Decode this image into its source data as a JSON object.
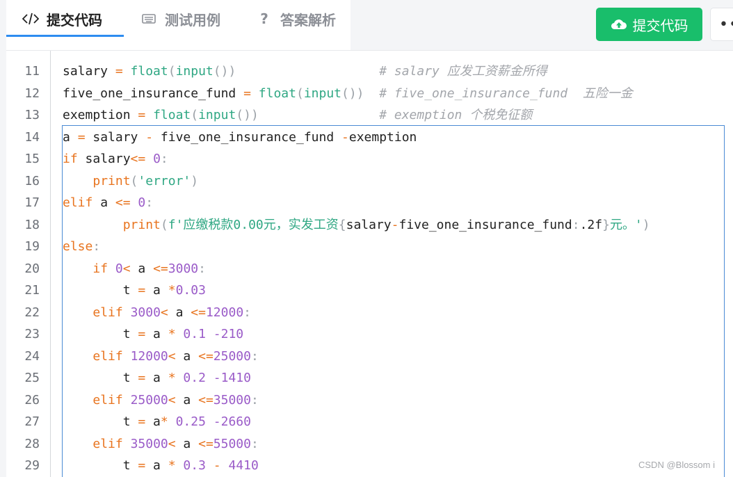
{
  "tabs": [
    {
      "label": "提交代码",
      "icon": "code-icon",
      "active": true
    },
    {
      "label": "测试用例",
      "icon": "keyboard-icon",
      "active": false
    },
    {
      "label": "答案解析",
      "icon": "question-icon",
      "active": false
    }
  ],
  "actions": {
    "submit_label": "提交代码",
    "submit_icon": "cloud-upload-icon",
    "more_icon": "more-icon",
    "more_label": "••"
  },
  "colors": {
    "accent": "#2d8cf0",
    "submit": "#19be6b",
    "keyword": "#e8741f",
    "builtin": "#2fa783",
    "number": "#9a5bc8",
    "comment": "#a3a6ab"
  },
  "editor": {
    "line_numbers": [
      "11",
      "12",
      "13",
      "14",
      "15",
      "16",
      "17",
      "18",
      "19",
      "20",
      "21",
      "22",
      "23",
      "24",
      "25",
      "26",
      "27",
      "28",
      "29"
    ],
    "lines": [
      {
        "tokens": [
          [
            "v",
            "salary "
          ],
          [
            "o",
            "="
          ],
          [
            "v",
            " "
          ],
          [
            "f",
            "float"
          ],
          [
            "p",
            "("
          ],
          [
            "f",
            "input"
          ],
          [
            "p",
            "())"
          ],
          [
            "v",
            "                   "
          ],
          [
            "c",
            "# salary 应发工资薪金所得"
          ]
        ]
      },
      {
        "tokens": [
          [
            "v",
            "five_one_insurance_fund "
          ],
          [
            "o",
            "="
          ],
          [
            "v",
            " "
          ],
          [
            "f",
            "float"
          ],
          [
            "p",
            "("
          ],
          [
            "f",
            "input"
          ],
          [
            "p",
            "())"
          ],
          [
            "v",
            "  "
          ],
          [
            "c",
            "# five_one_insurance_fund  五险一金"
          ]
        ]
      },
      {
        "tokens": [
          [
            "v",
            "exemption "
          ],
          [
            "o",
            "="
          ],
          [
            "v",
            " "
          ],
          [
            "f",
            "float"
          ],
          [
            "p",
            "("
          ],
          [
            "f",
            "input"
          ],
          [
            "p",
            "())"
          ],
          [
            "v",
            "                "
          ],
          [
            "c",
            "# exemption 个税免征额"
          ]
        ]
      },
      {
        "tokens": [
          [
            "v",
            "a "
          ],
          [
            "o",
            "="
          ],
          [
            "v",
            " salary "
          ],
          [
            "o",
            "-"
          ],
          [
            "v",
            " five_one_insurance_fund "
          ],
          [
            "o",
            "-"
          ],
          [
            "v",
            "exemption"
          ]
        ]
      },
      {
        "tokens": [
          [
            "k",
            "if"
          ],
          [
            "v",
            " salary"
          ],
          [
            "o",
            "<="
          ],
          [
            "v",
            " "
          ],
          [
            "n",
            "0"
          ],
          [
            "p",
            ":"
          ]
        ]
      },
      {
        "tokens": [
          [
            "v",
            "    "
          ],
          [
            "k",
            "print"
          ],
          [
            "p",
            "("
          ],
          [
            "s",
            "'error'"
          ],
          [
            "p",
            ")"
          ]
        ]
      },
      {
        "tokens": [
          [
            "k",
            "elif"
          ],
          [
            "v",
            " a "
          ],
          [
            "o",
            "<="
          ],
          [
            "v",
            " "
          ],
          [
            "n",
            "0"
          ],
          [
            "p",
            ":"
          ]
        ]
      },
      {
        "tokens": [
          [
            "v",
            "        "
          ],
          [
            "k",
            "print"
          ],
          [
            "p",
            "("
          ],
          [
            "s",
            "f'应缴税款0.00元，实发工资"
          ],
          [
            "p",
            "{"
          ],
          [
            "v",
            "salary"
          ],
          [
            "o",
            "-"
          ],
          [
            "v",
            "five_one_insurance_fund"
          ],
          [
            "p",
            ":"
          ],
          [
            "v",
            ".2f"
          ],
          [
            "p",
            "}"
          ],
          [
            "s",
            "元。'"
          ],
          [
            "p",
            ")"
          ]
        ]
      },
      {
        "tokens": [
          [
            "k",
            "else"
          ],
          [
            "p",
            ":"
          ]
        ]
      },
      {
        "tokens": [
          [
            "v",
            "    "
          ],
          [
            "k",
            "if"
          ],
          [
            "v",
            " "
          ],
          [
            "n",
            "0"
          ],
          [
            "o",
            "<"
          ],
          [
            "v",
            " a "
          ],
          [
            "o",
            "<="
          ],
          [
            "n",
            "3000"
          ],
          [
            "p",
            ":"
          ]
        ]
      },
      {
        "tokens": [
          [
            "v",
            "        t "
          ],
          [
            "o",
            "="
          ],
          [
            "v",
            " a "
          ],
          [
            "o",
            "*"
          ],
          [
            "n",
            "0.03"
          ]
        ]
      },
      {
        "tokens": [
          [
            "v",
            "    "
          ],
          [
            "k",
            "elif"
          ],
          [
            "v",
            " "
          ],
          [
            "n",
            "3000"
          ],
          [
            "o",
            "<"
          ],
          [
            "v",
            " a "
          ],
          [
            "o",
            "<="
          ],
          [
            "n",
            "12000"
          ],
          [
            "p",
            ":"
          ]
        ]
      },
      {
        "tokens": [
          [
            "v",
            "        t "
          ],
          [
            "o",
            "="
          ],
          [
            "v",
            " a "
          ],
          [
            "o",
            "*"
          ],
          [
            "v",
            " "
          ],
          [
            "n",
            "0.1"
          ],
          [
            "v",
            " "
          ],
          [
            "n",
            "-210"
          ]
        ]
      },
      {
        "tokens": [
          [
            "v",
            "    "
          ],
          [
            "k",
            "elif"
          ],
          [
            "v",
            " "
          ],
          [
            "n",
            "12000"
          ],
          [
            "o",
            "<"
          ],
          [
            "v",
            " a "
          ],
          [
            "o",
            "<="
          ],
          [
            "n",
            "25000"
          ],
          [
            "p",
            ":"
          ]
        ]
      },
      {
        "tokens": [
          [
            "v",
            "        t "
          ],
          [
            "o",
            "="
          ],
          [
            "v",
            " a "
          ],
          [
            "o",
            "*"
          ],
          [
            "v",
            " "
          ],
          [
            "n",
            "0.2"
          ],
          [
            "v",
            " "
          ],
          [
            "n",
            "-1410"
          ]
        ]
      },
      {
        "tokens": [
          [
            "v",
            "    "
          ],
          [
            "k",
            "elif"
          ],
          [
            "v",
            " "
          ],
          [
            "n",
            "25000"
          ],
          [
            "o",
            "<"
          ],
          [
            "v",
            " a "
          ],
          [
            "o",
            "<="
          ],
          [
            "n",
            "35000"
          ],
          [
            "p",
            ":"
          ]
        ]
      },
      {
        "tokens": [
          [
            "v",
            "        t "
          ],
          [
            "o",
            "="
          ],
          [
            "v",
            " a"
          ],
          [
            "o",
            "*"
          ],
          [
            "v",
            " "
          ],
          [
            "n",
            "0.25"
          ],
          [
            "v",
            " "
          ],
          [
            "n",
            "-2660"
          ]
        ]
      },
      {
        "tokens": [
          [
            "v",
            "    "
          ],
          [
            "k",
            "elif"
          ],
          [
            "v",
            " "
          ],
          [
            "n",
            "35000"
          ],
          [
            "o",
            "<"
          ],
          [
            "v",
            " a "
          ],
          [
            "o",
            "<="
          ],
          [
            "n",
            "55000"
          ],
          [
            "p",
            ":"
          ]
        ]
      },
      {
        "tokens": [
          [
            "v",
            "        t "
          ],
          [
            "o",
            "="
          ],
          [
            "v",
            " a "
          ],
          [
            "o",
            "*"
          ],
          [
            "v",
            " "
          ],
          [
            "n",
            "0.3"
          ],
          [
            "v",
            " "
          ],
          [
            "o",
            "-"
          ],
          [
            "v",
            " "
          ],
          [
            "n",
            "4410"
          ]
        ]
      }
    ]
  },
  "watermark": "CSDN @Blossom i"
}
